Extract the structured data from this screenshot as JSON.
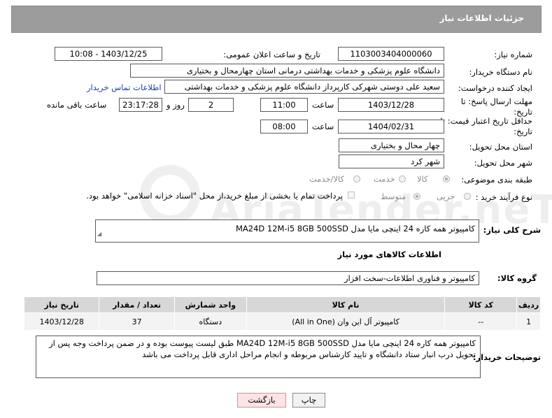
{
  "header": {
    "title": "جزئیات اطلاعات نیاز"
  },
  "watermark": "AriaTender.neT",
  "form": {
    "need_number_label": "شماره نیاز:",
    "need_number": "1103003404000060",
    "announce_label": "تاریخ و ساعت اعلان عمومی:",
    "announce_value": "1403/12/25 - 10:08",
    "buyer_org_label": "نام دستگاه خریدار:",
    "buyer_org": "دانشگاه علوم پزشکی و خدمات بهداشتی درمانی استان چهارمحال و بختیاری",
    "creator_label": "ایجاد کننده درخواست:",
    "creator": "سعید علی دوستی شهرکی کارپرداز دانشگاه علوم پزشکی و خدمات بهداشتی",
    "contact_link": "اطلاعات تماس خریدار",
    "deadline_label": "مهلت ارسال پاسخ: تا تاریخ:",
    "deadline_date": "1403/12/28",
    "time_label": "ساعت",
    "deadline_time": "11:00",
    "days_value": "2",
    "days_label": "روز و",
    "remaining_time": "23:17:28",
    "remaining_label": "ساعت باقی مانده",
    "price_validity_label": "حداقل تاریخ اعتبار قیمت: تا تاریخ:",
    "price_validity_date": "1404/02/31",
    "price_validity_time": "08:00",
    "province_label": "استان محل تحویل:",
    "province": "چهار محال و بختیاری",
    "city_label": "شهر محل تحویل:",
    "city": "شهر کرد",
    "category_label": "طبقه بندی موضوعی:",
    "category_options": [
      "کالا",
      "خدمت",
      "کالا/خدمت"
    ],
    "category_selected": "کالا",
    "process_label": "نوع فرآیند خرید :",
    "process_options": [
      "جزیی",
      "متوسط"
    ],
    "process_selected": "متوسط",
    "payment_note": "پرداخت تمام یا بخشی از مبلغ خرید،از محل \"اسناد خزانه اسلامی\" خواهد بود."
  },
  "summary": {
    "label": "شرح کلی نیاز:",
    "value": "کامپیوتر همه کاره 24 اینچی مایا مدل MA24D 12M-i5 8GB 500SSD"
  },
  "goods_section_title": "اطلاعات کالاهای مورد نیاز",
  "goods_group": {
    "label": "گروه کالا:",
    "value": "کامپیوتر و فناوری اطلاعات-سخت افزار"
  },
  "table": {
    "headers": [
      "ردیف",
      "کد کالا",
      "نام کالا",
      "واحد شمارش",
      "تعداد / مقدار",
      "تاریخ نیاز"
    ],
    "rows": [
      {
        "row": "1",
        "code": "--",
        "name": "کامپیوتر آل این وان (All in One)",
        "unit": "دستگاه",
        "qty": "37",
        "date": "1403/12/28"
      }
    ]
  },
  "buyer_notes": {
    "label": "توضیحات خریدار:",
    "line1": "کامپیوتر همه کاره 24 اینچی مایا مدل MA24D 12M-i5 8GB 500SSD طبق لیست پیوست بوده و در ضمن پرداخت وجه پس از",
    "line2": "تحویل درب انبار ستاد دانشگاه و تایید کارشناس مربوطه و انجام مراحل اداری قابل پرداخت می باشد"
  },
  "buttons": {
    "print": "چاپ",
    "back": "بازگشت"
  }
}
